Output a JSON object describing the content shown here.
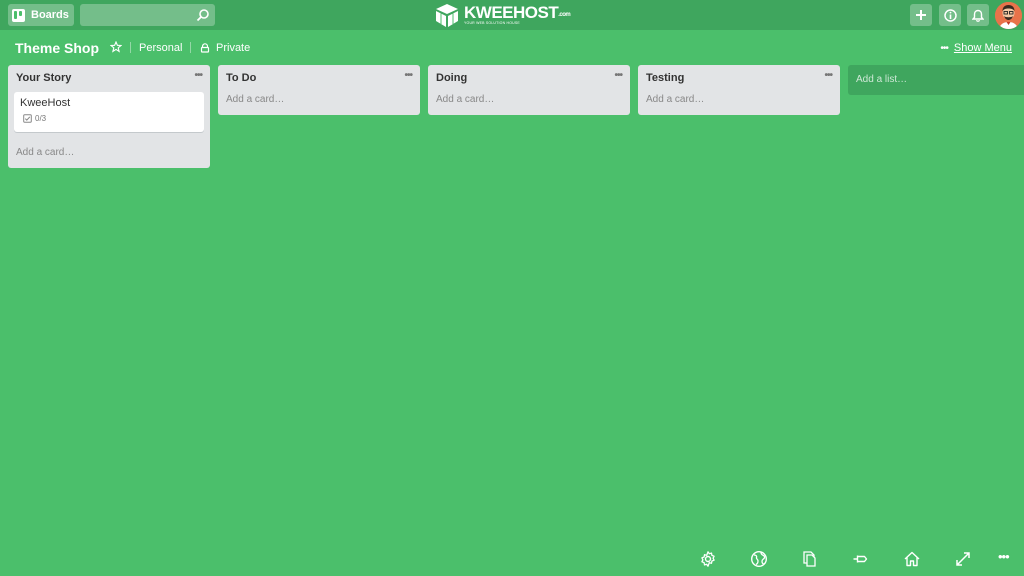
{
  "header": {
    "boards_label": "Boards",
    "search_placeholder": "",
    "logo_name": "KWEEHOST",
    "logo_suffix": ".com",
    "logo_tagline": "YOUR WEB SOLUTION HOUSE",
    "buttons": [
      "plus-icon",
      "info-icon",
      "bell-icon"
    ]
  },
  "board": {
    "title": "Theme Shop",
    "team": "Personal",
    "visibility": "Private",
    "show_menu": "Show Menu"
  },
  "lists": [
    {
      "title": "Your Story",
      "cards": [
        {
          "title": "KweeHost",
          "checklist": "0/3"
        }
      ],
      "add_card": "Add a card…"
    },
    {
      "title": "To Do",
      "cards": [],
      "add_card": "Add a card…"
    },
    {
      "title": "Doing",
      "cards": [],
      "add_card": "Add a card…"
    },
    {
      "title": "Testing",
      "cards": [],
      "add_card": "Add a card…"
    }
  ],
  "add_list": "Add a list…",
  "bottom_toolbar": [
    "gear-icon",
    "globe-icon",
    "copy-icon",
    "pin-icon",
    "home-icon",
    "expand-icon",
    "more-icon"
  ],
  "colors": {
    "background": "#4bbf6b",
    "header": "#3fa65e",
    "list": "#e2e4e6",
    "avatar": "#e8734a"
  }
}
